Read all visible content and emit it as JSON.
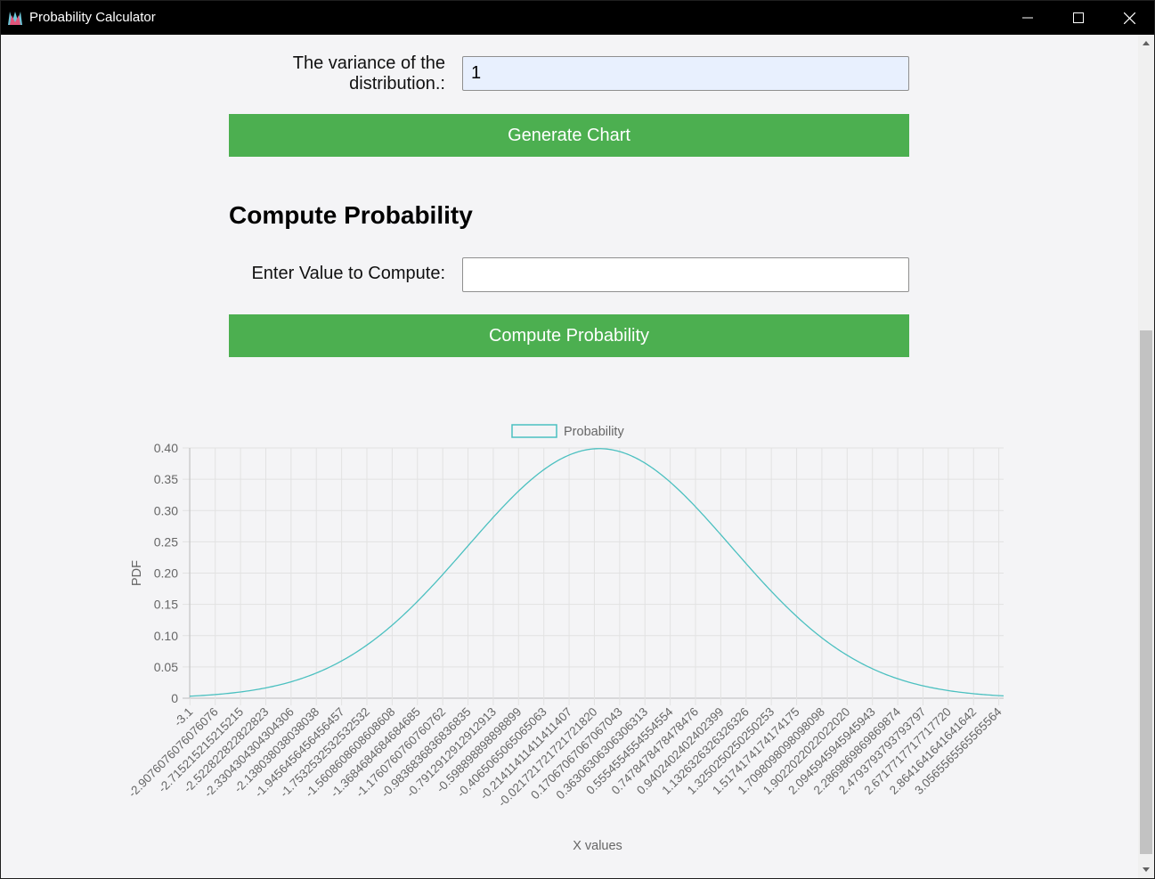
{
  "window": {
    "title": "Probability Calculator"
  },
  "form": {
    "variance_label_line1": "The variance of the",
    "variance_label_line2": "distribution.:",
    "variance_value": "1",
    "generate_button": "Generate Chart",
    "compute_heading": "Compute Probability",
    "compute_label": "Enter Value to Compute:",
    "compute_value": "",
    "compute_button": "Compute Probability"
  },
  "colors": {
    "button": "#4caf50",
    "series": "#4bc0c0",
    "titlebar": "#000000"
  },
  "chart_data": {
    "type": "line",
    "title": "",
    "xlabel": "X values",
    "ylabel": "PDF",
    "legend": "top",
    "grid": true,
    "ylim": [
      0,
      0.4
    ],
    "y_ticks": [
      "0",
      "0.05",
      "0.10",
      "0.15",
      "0.20",
      "0.25",
      "0.30",
      "0.35",
      "0.40"
    ],
    "x_tick_labels": [
      "-3.1",
      "-2.9076076076076076",
      "-2.715215215215215",
      "-2.522822822822823",
      "-2.3304304304304306",
      "-2.138038038038038",
      "-1.9456456456456457",
      "-1.7532532532532532",
      "-1.5608608608608608",
      "-1.3684684684684685",
      "-1.1760760760760762",
      "-0.9836836836836835",
      "-0.7912912912912913",
      "-0.598898898898899",
      "-0.4065065065065063",
      "-0.21411411411411407",
      "-0.021721721721721820",
      "0.17067067067067043",
      "0.36306306306306313",
      "0.5554554554554554",
      "0.7478478478478476",
      "0.9402402402402399",
      "1.1326326326326326",
      "1.3250250250250253",
      "1.5174174174174175",
      "1.7098098098098098",
      "1.9022022022022020",
      "2.0945945945945943",
      "2.2869869869869874",
      "2.4793793793793797",
      "2.6717717717717720",
      "2.8641641641641642",
      "3.0565565565565564"
    ],
    "series": [
      {
        "name": "Probability",
        "distribution": "normal",
        "mean": 0,
        "variance": 1,
        "x": [
          -3.1,
          -2.9,
          -2.7,
          -2.5,
          -2.3,
          -2.1,
          -1.9,
          -1.7,
          -1.5,
          -1.3,
          -1.1,
          -0.9,
          -0.7,
          -0.5,
          -0.3,
          -0.1,
          0.0,
          0.1,
          0.3,
          0.5,
          0.7,
          0.9,
          1.1,
          1.3,
          1.5,
          1.7,
          1.9,
          2.1,
          2.3,
          2.5,
          2.7,
          2.9,
          3.06
        ],
        "y": [
          0.0033,
          0.006,
          0.0104,
          0.0175,
          0.0283,
          0.044,
          0.0656,
          0.094,
          0.1295,
          0.1714,
          0.2179,
          0.2661,
          0.3123,
          0.3521,
          0.3814,
          0.397,
          0.3989,
          0.397,
          0.3814,
          0.3521,
          0.3123,
          0.2661,
          0.2179,
          0.1714,
          0.1295,
          0.094,
          0.0656,
          0.044,
          0.0283,
          0.0175,
          0.0104,
          0.006,
          0.0037
        ]
      }
    ]
  }
}
